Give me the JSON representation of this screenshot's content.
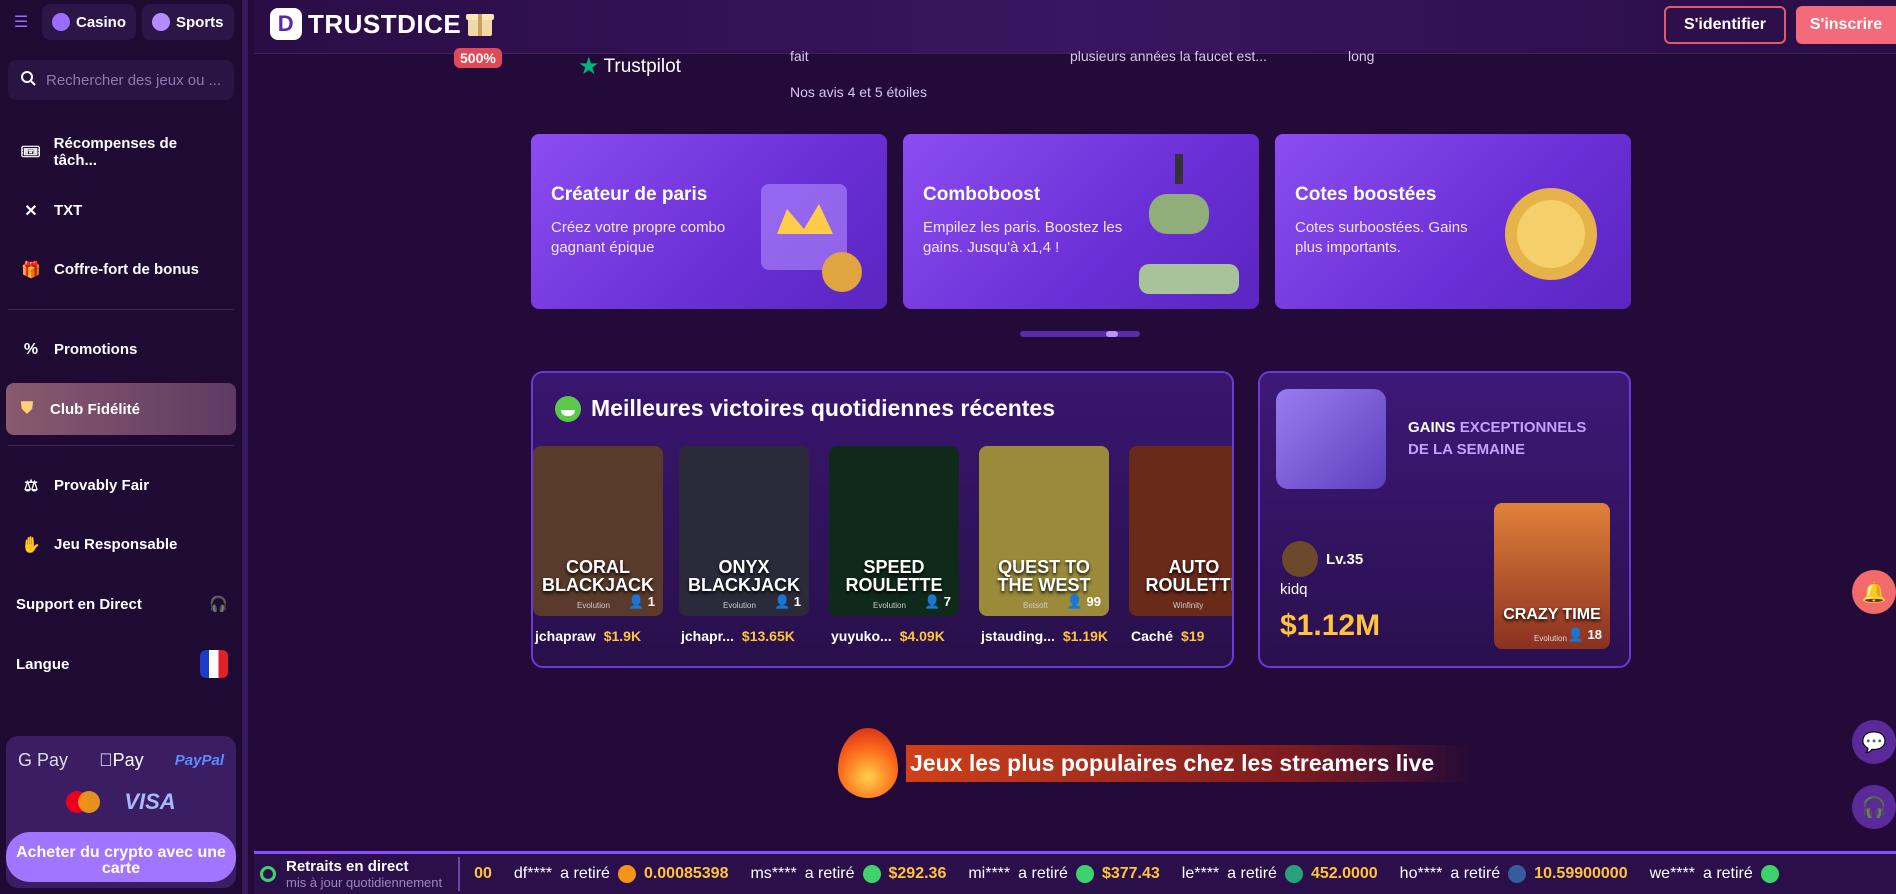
{
  "sidebar": {
    "tabs": [
      {
        "label": "Casino"
      },
      {
        "label": "Sports"
      }
    ],
    "search_placeholder": "Rechercher des jeux ou ...",
    "items": [
      {
        "label": "Récompenses de tâch...",
        "icon": "ticket-icon"
      },
      {
        "label": "TXT",
        "icon": "txt-icon"
      },
      {
        "label": "Coffre-fort de bonus",
        "icon": "gift-box-icon"
      },
      {
        "label": "Promotions",
        "icon": "percent-icon"
      },
      {
        "label": "Club Fidélité",
        "icon": "shield-icon"
      },
      {
        "label": "Provably Fair",
        "icon": "scale-icon"
      },
      {
        "label": "Jeu Responsable",
        "icon": "hand-icon"
      }
    ],
    "support": "Support en Direct",
    "language": "Langue",
    "payments": {
      "gpay": "G Pay",
      "applepay": "\u0000Pay",
      "paypal": "PayPal",
      "visa": "VISA"
    },
    "buy_crypto": "Acheter du crypto avec une carte"
  },
  "header": {
    "brand": "TRUSTDICE",
    "gift_badge": "500%",
    "login": "S'identifier",
    "register": "S'inscrire"
  },
  "trust": {
    "trustpilot": "Trustpilot",
    "frag1": "fait",
    "frag2": "Nos avis 4 et 5 étoiles",
    "frag3": "plusieurs années la faucet est...",
    "frag4": "long"
  },
  "promos": [
    {
      "title": "Créateur de paris",
      "desc": "Créez votre propre combo gagnant épique"
    },
    {
      "title": "Comboboost",
      "desc": "Empilez les paris. Boostez les gains. Jusqu'à x1,4 !"
    },
    {
      "title": "Cotes boostées",
      "desc": "Cotes surboostées. Gains plus importants."
    }
  ],
  "wins": {
    "title": "Meilleures victoires quotidiennes récentes",
    "games": [
      {
        "name": "CORAL BLACKJACK",
        "provider": "Evolution",
        "players": "1",
        "user": "jchapraw",
        "amount": "$1.9K",
        "bg": "#5a3a2a"
      },
      {
        "name": "ONYX BLACKJACK",
        "provider": "Evolution",
        "players": "1",
        "user": "jchapr...",
        "amount": "$13.65K",
        "bg": "#2a2a3a"
      },
      {
        "name": "SPEED ROULETTE",
        "provider": "Evolution",
        "players": "7",
        "user": "yuyuko...",
        "amount": "$4.09K",
        "bg": "#0f2a1a"
      },
      {
        "name": "QUEST TO THE WEST",
        "provider": "Betsoft",
        "players": "99",
        "user": "jstauding...",
        "amount": "$1.19K",
        "bg": "#9a8a3a"
      },
      {
        "name": "AUTO ROULETTE",
        "provider": "Winfinity",
        "players": "",
        "user": "Caché",
        "amount": "$19",
        "bg": "#6a2a1a"
      }
    ]
  },
  "weekly": {
    "title_a": "GAINS ",
    "title_b": "EXCEPTIONNELS DE LA SEMAINE",
    "level": "Lv.35",
    "user": "kidq",
    "amount": "$1.12M",
    "game": {
      "name": "CRAZY TIME",
      "provider": "Evolution",
      "players": "18"
    }
  },
  "streamers": "Jeux les plus populaires chez les streamers live",
  "ticker": {
    "title": "Retraits en direct",
    "subtitle": "mis à jour quotidiennement",
    "items": [
      {
        "user": "",
        "text": "",
        "amount": "00",
        "coin": "#f7931a"
      },
      {
        "user": "df****",
        "text": "a retiré",
        "amount": "0.00085398",
        "coin": "#f7931a"
      },
      {
        "user": "ms****",
        "text": "a retiré",
        "amount": "$292.36",
        "coin": "#3ed36a"
      },
      {
        "user": "mi****",
        "text": "a retiré",
        "amount": "$377.43",
        "coin": "#3ed36a"
      },
      {
        "user": "le****",
        "text": "a retiré",
        "amount": "452.0000",
        "coin": "#26a17b"
      },
      {
        "user": "ho****",
        "text": "a retiré",
        "amount": "10.59900000",
        "coin": "#345d9d"
      },
      {
        "user": "we****",
        "text": "a retiré",
        "amount": "",
        "coin": "#3ed36a"
      }
    ]
  }
}
